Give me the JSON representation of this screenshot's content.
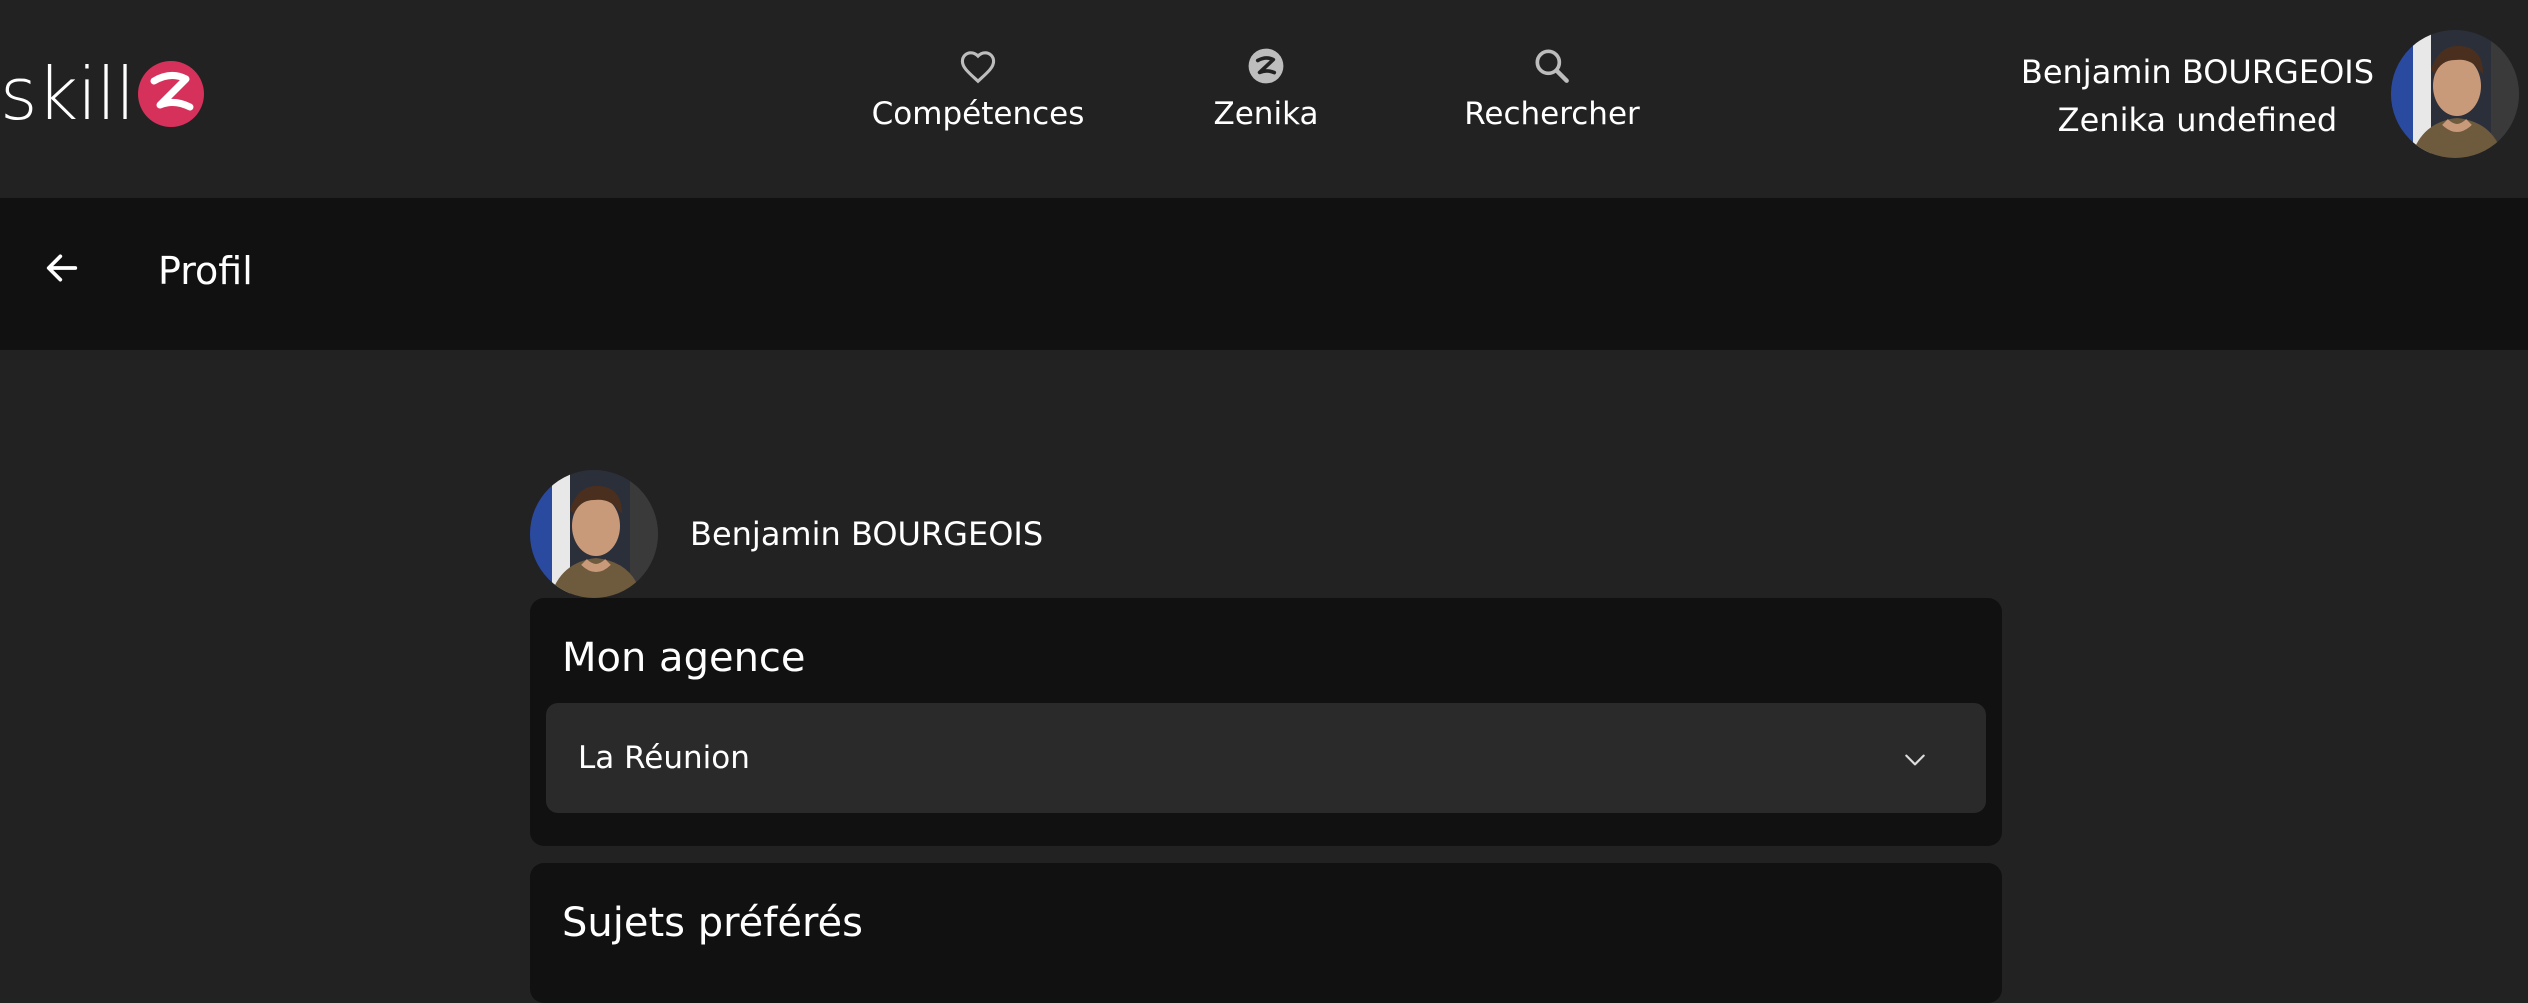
{
  "header": {
    "logo_text": "skill",
    "nav": [
      {
        "label": "Compétences",
        "icon": "heart-icon"
      },
      {
        "label": "Zenika",
        "icon": "zenika-icon"
      },
      {
        "label": "Rechercher",
        "icon": "search-icon"
      }
    ],
    "user": {
      "name": "Benjamin BOURGEOIS",
      "agency": "Zenika undefined"
    }
  },
  "subbar": {
    "title": "Profil"
  },
  "profile": {
    "name": "Benjamin BOURGEOIS"
  },
  "agency_card": {
    "title": "Mon agence",
    "selected": "La Réunion"
  },
  "topics_card": {
    "title": "Sujets préférés"
  },
  "colors": {
    "background": "#222222",
    "bar": "#111111",
    "card": "#111111",
    "select": "#2a2a2a",
    "brand": "#d6315a"
  }
}
